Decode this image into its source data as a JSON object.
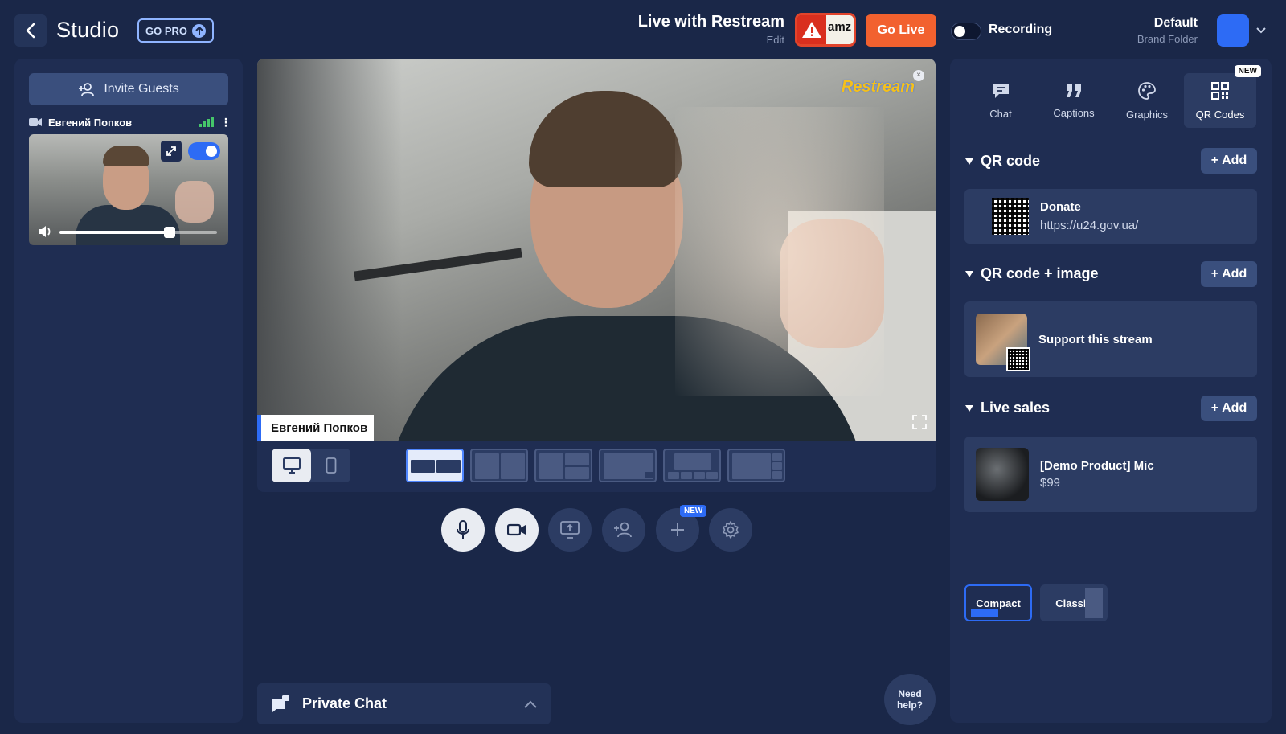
{
  "topbar": {
    "title": "Studio",
    "gopro_label": "GO PRO",
    "stream_title": "Live with Restream",
    "stream_edit": "Edit",
    "platform_text": "amz",
    "golive_label": "Go Live",
    "recording_label": "Recording",
    "recording_on": false,
    "brand_name": "Default",
    "brand_sub": "Brand Folder",
    "brand_color": "#2d6bf5"
  },
  "left": {
    "invite_label": "Invite Guests",
    "guest_name": "Евгений Попков",
    "guest_volume": 0.7
  },
  "stage": {
    "logo": "Restream",
    "name_tag": "Евгений Попков"
  },
  "private_chat": {
    "label": "Private Chat"
  },
  "help": {
    "line1": "Need",
    "line2": "help?"
  },
  "controls": {
    "new_badge": "NEW"
  },
  "right": {
    "tabs": [
      {
        "label": "Chat",
        "icon": "chat-icon"
      },
      {
        "label": "Captions",
        "icon": "quote-icon"
      },
      {
        "label": "Graphics",
        "icon": "palette-icon"
      },
      {
        "label": "QR Codes",
        "icon": "qr-icon",
        "badge": "NEW"
      }
    ],
    "add_label": "Add",
    "sections": {
      "qr": {
        "heading": "QR code",
        "item_title": "Donate",
        "item_url": "https://u24.gov.ua/"
      },
      "qr_image": {
        "heading": "QR code + image",
        "item_title": "Support this stream"
      },
      "live_sales": {
        "heading": "Live sales",
        "item_title": "[Demo Product] Mic",
        "item_price": "$99"
      }
    },
    "modes": {
      "compact": "Compact",
      "classic": "Classic"
    }
  },
  "accent_colors": {
    "accent": "#2d6bf5",
    "golive": "#f2612f",
    "bg": "#1a2748",
    "panel": "#1f2d52"
  }
}
